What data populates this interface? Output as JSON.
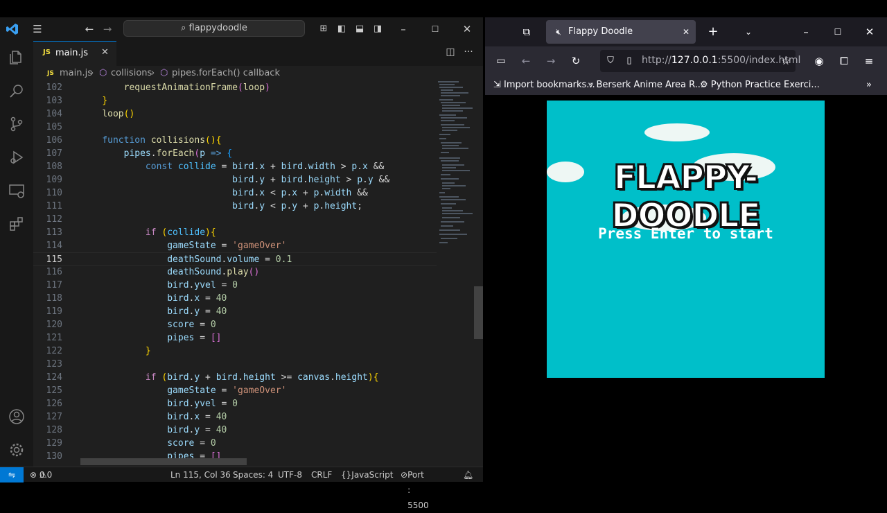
{
  "vscode": {
    "search": "flappydoodle",
    "tab_label": "main.js",
    "tab_lang": "JS",
    "breadcrumb": [
      "main.js",
      "collisions",
      "pipes.forEach() callback"
    ],
    "lines": [
      {
        "n": "102",
        "html": "        <span class='fn'>requestAnimationFrame</span><span class='br2'>(</span><span class='fn'>loop</span><span class='br2'>)</span>"
      },
      {
        "n": "103",
        "html": "    <span class='br'>}</span>"
      },
      {
        "n": "104",
        "html": "    <span class='fn'>loop</span><span class='br'>()</span>"
      },
      {
        "n": "105",
        "html": ""
      },
      {
        "n": "106",
        "html": "    <span class='kw'>function</span> <span class='fn'>collisions</span><span class='br'>()</span><span class='br'>{</span>"
      },
      {
        "n": "107",
        "html": "        <span class='var'>pipes</span>.<span class='fn'>forEach</span><span class='br2'>(</span><span class='var'>p</span> <span class='kw'>=&gt;</span> <span class='br3'>{</span>"
      },
      {
        "n": "108",
        "html": "            <span class='kw'>const</span> <span class='cn'>collide</span> = <span class='var'>bird</span>.<span class='var'>x</span> + <span class='var'>bird</span>.<span class='var'>width</span> &gt; <span class='var'>p</span>.<span class='var'>x</span> &amp;&amp;"
      },
      {
        "n": "109",
        "html": "                            <span class='var'>bird</span>.<span class='var'>y</span> + <span class='var'>bird</span>.<span class='var'>height</span> &gt; <span class='var'>p</span>.<span class='var'>y</span> &amp;&amp;"
      },
      {
        "n": "110",
        "html": "                            <span class='var'>bird</span>.<span class='var'>x</span> &lt; <span class='var'>p</span>.<span class='var'>x</span> + <span class='var'>p</span>.<span class='var'>width</span> &amp;&amp;"
      },
      {
        "n": "111",
        "html": "                            <span class='var'>bird</span>.<span class='var'>y</span> &lt; <span class='var'>p</span>.<span class='var'>y</span> + <span class='var'>p</span>.<span class='var'>height</span>;"
      },
      {
        "n": "112",
        "html": ""
      },
      {
        "n": "113",
        "html": "            <span class='ctl'>if</span> <span class='br'>(</span><span class='cn'>collide</span><span class='br'>)</span><span class='br'>{</span>"
      },
      {
        "n": "114",
        "html": "                <span class='var'>gameState</span> = <span class='str'>'gameOver'</span>"
      },
      {
        "n": "115",
        "html": "                <span class='var'>deathSound</span>.<span class='var'>volume</span> = <span class='num'>0.1</span>"
      },
      {
        "n": "116",
        "html": "                <span class='var'>deathSound</span>.<span class='fn'>play</span><span class='br2'>()</span>"
      },
      {
        "n": "117",
        "html": "                <span class='var'>bird</span>.<span class='var'>yvel</span> = <span class='num'>0</span>"
      },
      {
        "n": "118",
        "html": "                <span class='var'>bird</span>.<span class='var'>x</span> = <span class='num'>40</span>"
      },
      {
        "n": "119",
        "html": "                <span class='var'>bird</span>.<span class='var'>y</span> = <span class='num'>40</span>"
      },
      {
        "n": "120",
        "html": "                <span class='var'>score</span> = <span class='num'>0</span>"
      },
      {
        "n": "121",
        "html": "                <span class='var'>pipes</span> = <span class='br2'>[]</span>"
      },
      {
        "n": "122",
        "html": "            <span class='br'>}</span>"
      },
      {
        "n": "123",
        "html": ""
      },
      {
        "n": "124",
        "html": "            <span class='ctl'>if</span> <span class='br'>(</span><span class='var'>bird</span>.<span class='var'>y</span> + <span class='var'>bird</span>.<span class='var'>height</span> &gt;= <span class='var'>canvas</span>.<span class='var'>height</span><span class='br'>)</span><span class='br'>{</span>"
      },
      {
        "n": "125",
        "html": "                <span class='var'>gameState</span> = <span class='str'>'gameOver'</span>"
      },
      {
        "n": "126",
        "html": "                <span class='var'>bird</span>.<span class='var'>yvel</span> = <span class='num'>0</span>"
      },
      {
        "n": "127",
        "html": "                <span class='var'>bird</span>.<span class='var'>x</span> = <span class='num'>40</span>"
      },
      {
        "n": "128",
        "html": "                <span class='var'>bird</span>.<span class='var'>y</span> = <span class='num'>40</span>"
      },
      {
        "n": "129",
        "html": "                <span class='var'>score</span> = <span class='num'>0</span>"
      },
      {
        "n": "130",
        "html": "                <span class='var'>pipes</span> = <span class='br2'>[]</span>"
      }
    ],
    "active_line": "115",
    "status": {
      "problems": "0",
      "warnings": "0",
      "cursor": "Ln 115, Col 36",
      "spaces": "Spaces: 4",
      "encoding": "UTF-8",
      "eol": "CRLF",
      "lang": "JavaScript",
      "port": "Port : 5500"
    }
  },
  "browser": {
    "tab_title": "Flappy Doodle",
    "url_prefix": "http://",
    "url_host": "127.0.0.1",
    "url_rest": ":5500/index.html",
    "bookmarks": [
      "Import bookmarks...",
      "Berserk Anime Area R...",
      "Python Practice Exerci..."
    ],
    "game_title": "FLAPPY-DOODLE",
    "game_prompt": "Press Enter to start"
  },
  "colors": {
    "accent": "#0078d4",
    "game_bg": "#00bfc9",
    "status_remote": "#0078d4"
  },
  "icons": [
    "vscode-logo-icon",
    "menu-icon",
    "back-arrow-icon",
    "forward-arrow-icon",
    "search-icon",
    "layout-icon",
    "explorer-icon",
    "search-activity-icon",
    "source-control-icon",
    "run-debug-icon",
    "remote-explorer-icon",
    "extensions-icon",
    "account-icon",
    "settings-gear-icon",
    "close-icon",
    "split-editor-icon",
    "more-actions-icon",
    "minimize-icon",
    "maximize-icon",
    "reload-icon",
    "shield-icon",
    "page-icon",
    "star-icon",
    "profile-icon",
    "extension-puzzle-icon",
    "hamburger-icon",
    "sidebar-icon",
    "tab-list-icon",
    "mute-icon",
    "plus-icon",
    "chevron-down-icon",
    "overflow-icon",
    "bell-icon"
  ]
}
